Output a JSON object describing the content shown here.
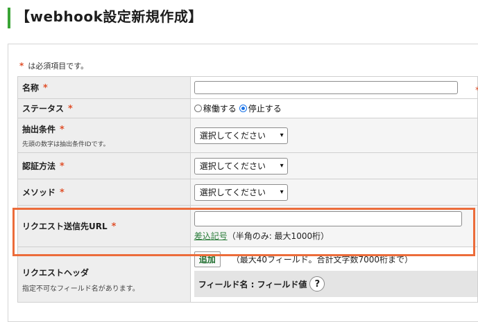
{
  "header": {
    "title": "【webhook設定新規作成】"
  },
  "form": {
    "required_note": "は必須項目です。",
    "required_mark": "*",
    "rows": {
      "name": {
        "label": "名称",
        "value": ""
      },
      "status": {
        "label": "ステータス",
        "options": [
          "稼働する",
          "停止する"
        ],
        "selected": "停止する"
      },
      "extract": {
        "label": "抽出条件",
        "note": "先頭の数字は抽出条件IDです。",
        "select": "選択してください"
      },
      "auth": {
        "label": "認証方法",
        "select": "選択してください"
      },
      "method": {
        "label": "メソッド",
        "select": "選択してください"
      },
      "url": {
        "label": "リクエスト送信先URL",
        "value": "",
        "link": "差込記号",
        "hint": "（半角のみ: 最大1000桁）"
      },
      "headers": {
        "label": "リクエストヘッダ",
        "note": "指定不可なフィールド名があります。",
        "add_button": "追加",
        "limit_note": "（最大40フィールド。合計文字数7000桁まで）",
        "field_header": "フィールド名 : フィールド値"
      }
    }
  },
  "colors": {
    "accent_green": "#3aa435",
    "required_red": "#e0502a",
    "highlight_orange": "#ec6c3a"
  },
  "icons": {
    "help": "?",
    "chevron": "▾"
  }
}
